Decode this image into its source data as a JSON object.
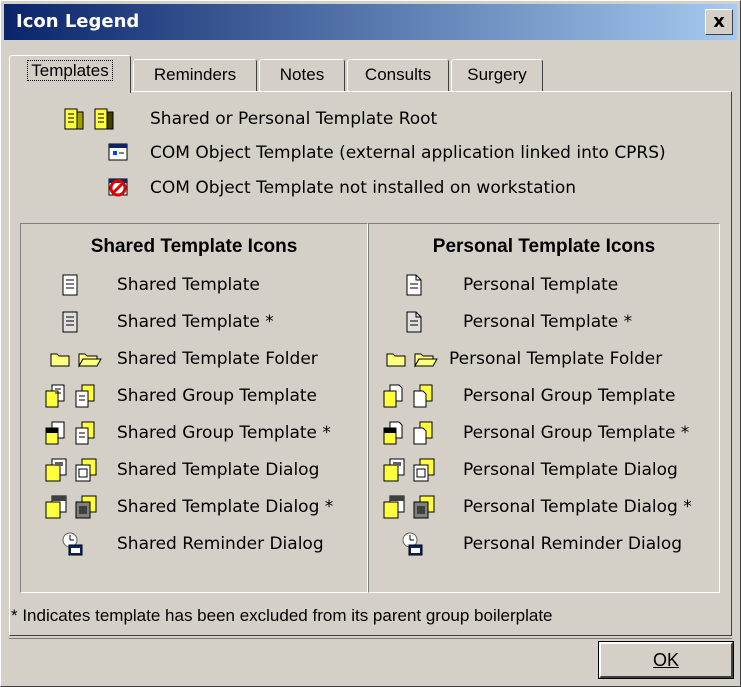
{
  "window": {
    "title": "Icon Legend",
    "close_label": "x"
  },
  "tabs": [
    {
      "label": "Templates",
      "active": true
    },
    {
      "label": "Reminders"
    },
    {
      "label": "Notes"
    },
    {
      "label": "Consults"
    },
    {
      "label": "Surgery"
    }
  ],
  "legend_top": [
    {
      "icon": "template-root-icon",
      "label": "Shared or Personal Template Root"
    },
    {
      "icon": "com-object-icon",
      "label": "COM Object Template (external application linked into CPRS)"
    },
    {
      "icon": "com-not-installed-icon",
      "label": "COM Object Template not installed on workstation"
    }
  ],
  "shared": {
    "header": "Shared Template Icons",
    "items": [
      {
        "icon": "shared-template-icon",
        "label": "Shared Template"
      },
      {
        "icon": "shared-template-excluded-icon",
        "label": "Shared Template *"
      },
      {
        "icon": "shared-folder-icon",
        "label": "Shared Template Folder"
      },
      {
        "icon": "shared-group-icon",
        "label": "Shared Group Template"
      },
      {
        "icon": "shared-group-excluded-icon",
        "label": "Shared Group Template *"
      },
      {
        "icon": "shared-dialog-icon",
        "label": "Shared Template Dialog"
      },
      {
        "icon": "shared-dialog-excluded-icon",
        "label": "Shared Template Dialog *"
      },
      {
        "icon": "shared-reminder-icon",
        "label": "Shared Reminder Dialog"
      }
    ]
  },
  "personal": {
    "header": "Personal Template Icons",
    "items": [
      {
        "icon": "personal-template-icon",
        "label": "Personal Template"
      },
      {
        "icon": "personal-template-excluded-icon",
        "label": "Personal Template *"
      },
      {
        "icon": "personal-folder-icon",
        "label": "Personal Template Folder"
      },
      {
        "icon": "personal-group-icon",
        "label": "Personal Group Template"
      },
      {
        "icon": "personal-group-excluded-icon",
        "label": "Personal Group Template *"
      },
      {
        "icon": "personal-dialog-icon",
        "label": "Personal Template Dialog"
      },
      {
        "icon": "personal-dialog-excluded-icon",
        "label": "Personal Template Dialog *"
      },
      {
        "icon": "personal-reminder-icon",
        "label": "Personal Reminder Dialog"
      }
    ]
  },
  "footnote": "* Indicates template has been excluded from its parent group boilerplate",
  "ok_button": {
    "label": "OK"
  },
  "colors": {
    "title_start": "#0a246a",
    "title_end": "#a6caf0",
    "face": "#d4d0c8",
    "folder_yellow": "#ffff80"
  }
}
